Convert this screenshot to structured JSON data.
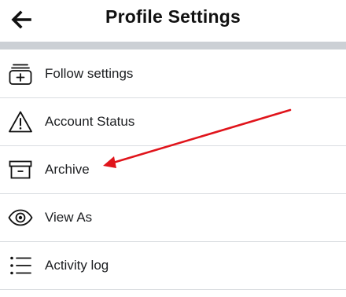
{
  "header": {
    "title": "Profile Settings",
    "back_icon": "arrow-left-icon"
  },
  "menu": {
    "items": [
      {
        "label": "Follow settings",
        "icon": "follow-settings-icon"
      },
      {
        "label": "Account Status",
        "icon": "warning-icon"
      },
      {
        "label": "Archive",
        "icon": "archive-box-icon"
      },
      {
        "label": "View As",
        "icon": "eye-icon"
      },
      {
        "label": "Activity log",
        "icon": "list-icon"
      }
    ]
  },
  "colors": {
    "divider_band": "#ccd0d5",
    "annotation_arrow": "#e0141b"
  }
}
